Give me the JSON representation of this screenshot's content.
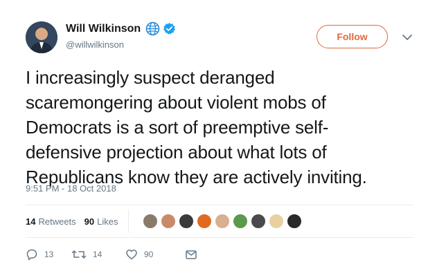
{
  "author": {
    "name": "Will Wilkinson",
    "handle": "@willwilkinson"
  },
  "follow_button": {
    "label": "Follow"
  },
  "tweet": {
    "text": "I increasingly suspect deranged\nscaremongering about violent mobs of\nDemocrats is a sort of preemptive self-\ndefensive projection about what lots of\nRepublicans know they are actively inviting.",
    "timestamp": "9:51 PM - 18 Oct 2018"
  },
  "stats": {
    "retweets_count": "14",
    "retweets_label": "Retweets",
    "likes_count": "90",
    "likes_label": "Likes"
  },
  "liker_avatars": [
    "#8a7a6a",
    "#c98a6a",
    "#3a3a3a",
    "#e06a20",
    "#d8b090",
    "#5a9a4a",
    "#4a4a4a",
    "#e8d0a0",
    "#2a2a2a"
  ],
  "actions": {
    "replies": "13",
    "retweets": "14",
    "likes": "90"
  },
  "colors": {
    "accent": "#e0683f",
    "verified": "#1da1f2",
    "globe": "#2a8ad8",
    "muted": "#657786"
  },
  "icons": {
    "globe": "globe-icon",
    "verified": "verified-badge-icon",
    "chevron": "chevron-down-icon",
    "reply": "reply-icon",
    "retweet": "retweet-icon",
    "like": "heart-icon",
    "dm": "envelope-icon"
  }
}
